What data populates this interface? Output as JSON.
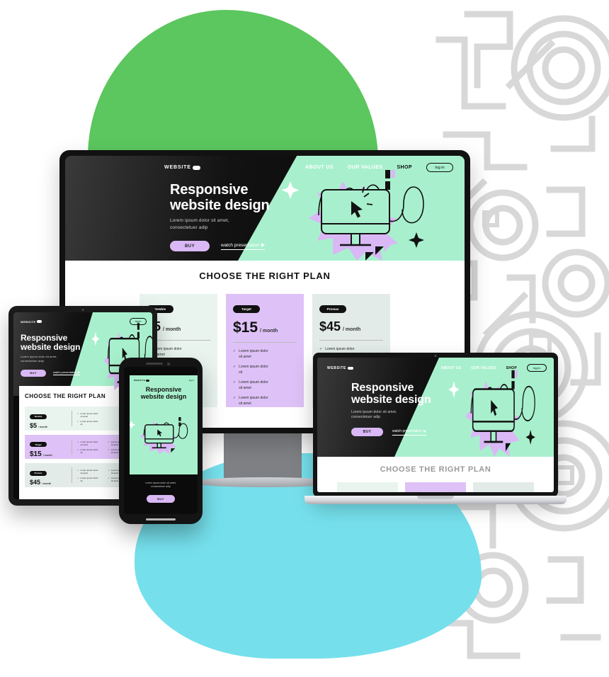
{
  "palette": {
    "green_blob": "#5BC75E",
    "cyan_blob": "#75E0EC",
    "mint": "#A8F0CD",
    "lilac": "#D9B8F5",
    "dark": "#0B0B0B",
    "maze_gray": "#D8D8D8",
    "card_mint": "#E9F4EF",
    "card_lilac": "#DEC2F7",
    "card_sage": "#E2EBE7"
  },
  "site": {
    "brand": "WEBSITE",
    "nav": [
      {
        "label": "ABOUT US"
      },
      {
        "label": "OUR VALUES"
      },
      {
        "label": "SHOP"
      }
    ],
    "login_label": "log in",
    "hero": {
      "title_line1": "Responsive",
      "title_line2": "website design",
      "subtitle_line1": "Lorem ipsum dolor sit amet,",
      "subtitle_line2": "consectetuer adip",
      "buy_label": "BUY",
      "watch_label": "watch presentation"
    },
    "plans": {
      "heading": "CHOOSE THE RIGHT PLAN",
      "feature_line1": "Lorem ipsum dolor",
      "feature_line2": "sit amet",
      "feature_short": "Lorem ipsum dolor",
      "feature_short2": "sit",
      "cards": [
        {
          "badge": "Newbie",
          "price": "$5",
          "period": "/ month",
          "theme": "mint",
          "features": [
            {
              "l1": "Lorem ipsum dolor",
              "l2": "sit amet"
            },
            {
              "l1": "Lorem ipsum dolor",
              "l2": "sit"
            }
          ]
        },
        {
          "badge": "Target",
          "price": "$15",
          "period": "/ month",
          "theme": "lilac",
          "features": [
            {
              "l1": "Lorem ipsum dolor",
              "l2": "sit amet"
            },
            {
              "l1": "Lorem ipsum dolor",
              "l2": "sit"
            },
            {
              "l1": "Lorem ipsum dolor",
              "l2": "sit amet"
            },
            {
              "l1": "Lorem ipsum dolor",
              "l2": "sit amet"
            }
          ]
        },
        {
          "badge": "Promax",
          "price": "$45",
          "period": "/ month",
          "theme": "sage",
          "features": [
            {
              "l1": "Lorem ipsum dolor",
              "l2": "sit amet"
            }
          ]
        }
      ]
    }
  },
  "devices": [
    {
      "name": "desktop-monitor",
      "label": "Desktop monitor"
    },
    {
      "name": "tablet",
      "label": "Tablet"
    },
    {
      "name": "phone",
      "label": "Phone"
    },
    {
      "name": "laptop",
      "label": "Laptop"
    }
  ]
}
